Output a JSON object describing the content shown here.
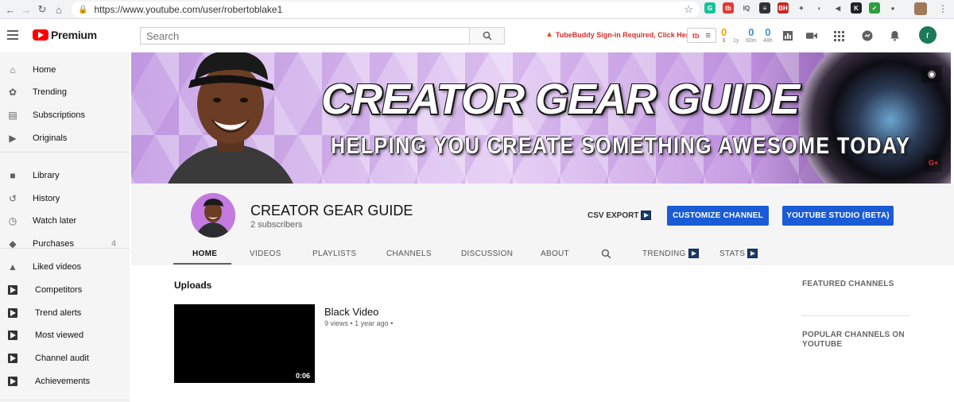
{
  "browser": {
    "url": "https://www.youtube.com/user/robertoblake1",
    "extensions": [
      {
        "icon": "grammarly-icon",
        "text": "G",
        "color": "#15c39a"
      },
      {
        "icon": "tubebuddy-icon",
        "text": "tb",
        "color": "#e53935"
      },
      {
        "icon": "iq-icon",
        "text": "IQ",
        "color": "#ffffff"
      },
      {
        "icon": "buffer-icon",
        "text": "≡",
        "color": "#333333"
      },
      {
        "icon": "bh-icon",
        "text": "BH",
        "color": "#c62828"
      },
      {
        "icon": "runner-icon",
        "text": "✦",
        "color": "#ffffff"
      },
      {
        "icon": "circle-icon",
        "text": "◐",
        "color": "#ffffff"
      },
      {
        "icon": "megaphone-icon",
        "text": "◀",
        "color": "#ffffff"
      },
      {
        "icon": "k-icon",
        "text": "K",
        "color": "#222222"
      },
      {
        "icon": "check-icon",
        "text": "✓",
        "color": "#2e9e3e"
      },
      {
        "icon": "dot-icon",
        "text": "●",
        "color": "#ffffff"
      }
    ]
  },
  "header": {
    "logo_text": "Premium",
    "search_placeholder": "Search",
    "tubebuddy_warning": "TubeBuddy Sign-in Required, Click Here",
    "stats": [
      {
        "value": "0",
        "label": "$",
        "color": "#f0a500"
      },
      {
        "value": "0",
        "label": "1y",
        "color": "#3d8fd6"
      },
      {
        "value": "0",
        "label": "60m",
        "color": "#3d8fd6"
      },
      {
        "value": "0",
        "label": "48h",
        "color": "#3d8fd6"
      }
    ],
    "avatar_letter": "r"
  },
  "sidebar": {
    "items": [
      {
        "label": "Home",
        "icon": "home-icon",
        "count": ""
      },
      {
        "label": "Trending",
        "icon": "flame-icon",
        "count": ""
      },
      {
        "label": "Subscriptions",
        "icon": "subscriptions-icon",
        "count": ""
      },
      {
        "label": "Originals",
        "icon": "originals-icon",
        "count": ""
      },
      {
        "label": "Library",
        "icon": "folder-icon",
        "count": ""
      },
      {
        "label": "History",
        "icon": "history-icon",
        "count": ""
      },
      {
        "label": "Watch later",
        "icon": "clock-icon",
        "count": ""
      },
      {
        "label": "Purchases",
        "icon": "tag-icon",
        "count": "4"
      },
      {
        "label": "Liked videos",
        "icon": "thumbs-up-icon",
        "count": ""
      },
      {
        "label": "Competitors",
        "icon": "tubebuddy-icon",
        "count": ""
      },
      {
        "label": "Trend alerts",
        "icon": "tubebuddy-icon",
        "count": ""
      },
      {
        "label": "Most viewed",
        "icon": "tubebuddy-icon",
        "count": ""
      },
      {
        "label": "Channel audit",
        "icon": "tubebuddy-icon",
        "count": ""
      },
      {
        "label": "Achievements",
        "icon": "tubebuddy-icon",
        "count": ""
      }
    ]
  },
  "banner": {
    "title": "CREATOR GEAR GUIDE",
    "subtitle": "HELPING YOU CREATE SOMETHING AWESOME TODAY"
  },
  "channel": {
    "name": "CREATOR GEAR GUIDE",
    "subscribers": "2 subscribers",
    "csv_export": "CSV EXPORT",
    "customize_button": "CUSTOMIZE CHANNEL",
    "studio_button": "YOUTUBE STUDIO (BETA)",
    "tabs": [
      "HOME",
      "VIDEOS",
      "PLAYLISTS",
      "CHANNELS",
      "DISCUSSION",
      "ABOUT",
      "TRENDING",
      "STATS"
    ]
  },
  "main": {
    "uploads_title": "Uploads",
    "video": {
      "title": "Black Video",
      "meta": "9 views • 1 year ago •",
      "duration": "0:06"
    },
    "featured_channels": "FEATURED CHANNELS",
    "popular_channels": "POPULAR CHANNELS ON YOUTUBE"
  }
}
